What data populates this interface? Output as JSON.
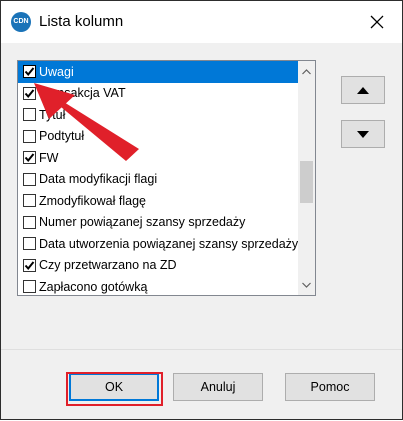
{
  "window": {
    "title": "Lista kolumn",
    "icon": "app-logo-icon",
    "close_icon": "close-icon"
  },
  "list": {
    "items": [
      {
        "label": "Uwagi",
        "checked": true,
        "selected": true
      },
      {
        "label": "Transakcja VAT",
        "checked": true,
        "selected": false
      },
      {
        "label": "Tytuł",
        "checked": false,
        "selected": false
      },
      {
        "label": "Podtytuł",
        "checked": false,
        "selected": false
      },
      {
        "label": "FW",
        "checked": true,
        "selected": false
      },
      {
        "label": "Data modyfikacji flagi",
        "checked": false,
        "selected": false
      },
      {
        "label": "Zmodyfikował flagę",
        "checked": false,
        "selected": false
      },
      {
        "label": "Numer powiązanej szansy sprzedaży",
        "checked": false,
        "selected": false
      },
      {
        "label": "Data utworzenia powiązanej szansy sprzedaży",
        "checked": false,
        "selected": false
      },
      {
        "label": "Czy przetwarzano na ZD",
        "checked": true,
        "selected": false
      },
      {
        "label": "Zapłacono gotówką",
        "checked": false,
        "selected": false
      }
    ]
  },
  "move": {
    "up_icon": "triangle-up-icon",
    "down_icon": "triangle-down-icon"
  },
  "buttons": {
    "ok": "OK",
    "cancel": "Anuluj",
    "help": "Pomoc"
  },
  "annotation": {
    "arrow_color": "#e0202a",
    "highlight_color": "#e0202a"
  }
}
